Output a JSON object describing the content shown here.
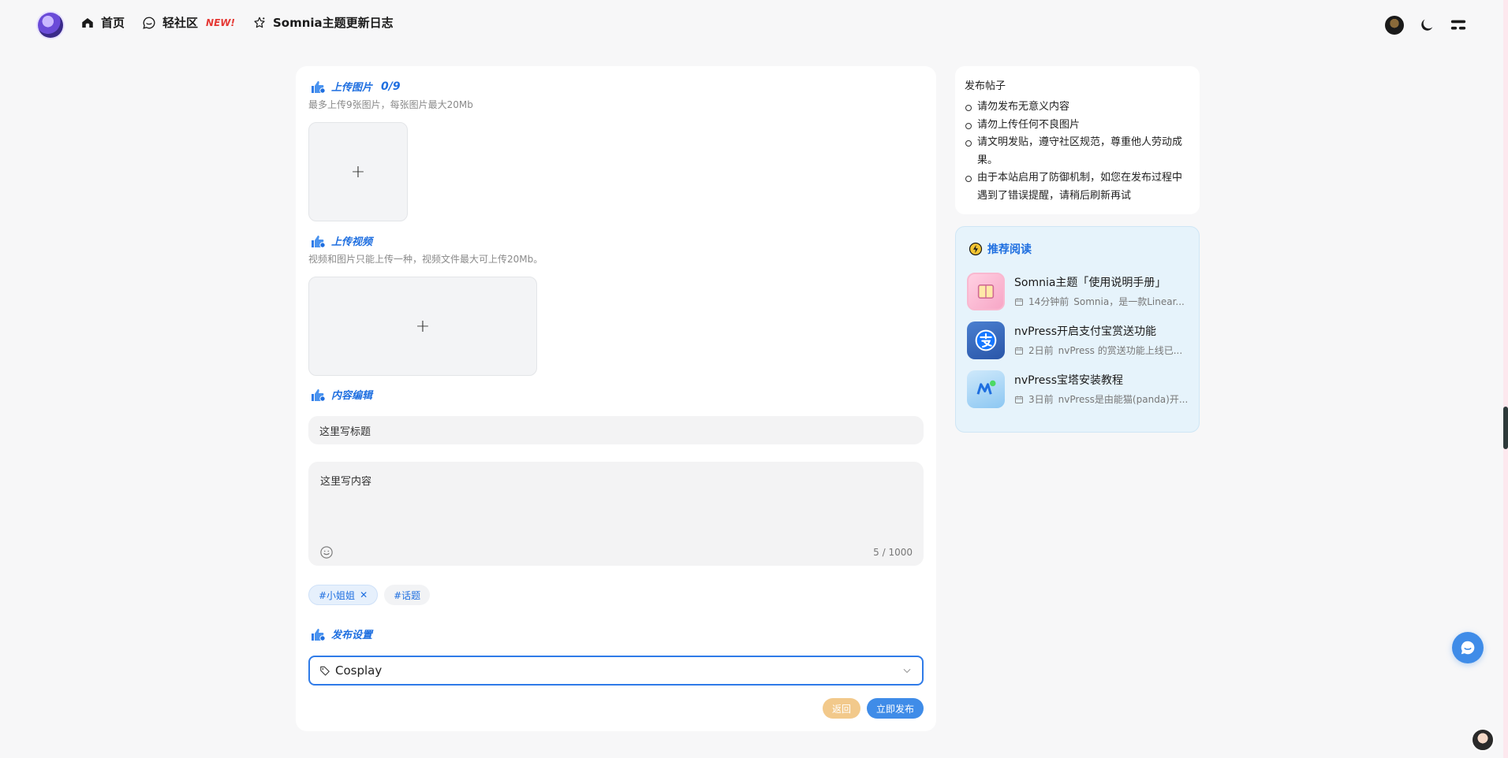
{
  "nav": {
    "home_label": "首页",
    "community_label": "轻社区",
    "community_badge": "NEW!",
    "changelog_label": "Somnia主题更新日志"
  },
  "upload_images": {
    "title": "上传图片",
    "count": "0/9",
    "hint": "最多上传9张图片，每张图片最大20Mb",
    "plus": "+"
  },
  "upload_video": {
    "title": "上传视频",
    "hint": "视频和图片只能上传一种，视频文件最大可上传20Mb。",
    "plus": "+"
  },
  "content_edit": {
    "title": "内容编辑",
    "title_placeholder": "这里写标题",
    "content_placeholder": "这里写内容",
    "counter": "5 / 1000"
  },
  "tags": [
    {
      "label": "#小姐姐",
      "close": "✕"
    },
    {
      "label": "#话题"
    }
  ],
  "publish_settings": {
    "title": "发布设置",
    "category": "Cosplay"
  },
  "buttons": {
    "back": "返回",
    "publish": "立即发布"
  },
  "rules": {
    "title": "发布帖子",
    "items": [
      "请勿发布无意义内容",
      "请勿上传任何不良图片",
      "请文明发贴，遵守社区规范，尊重他人劳动成果。",
      "由于本站启用了防御机制，如您在发布过程中遇到了错误提醒，请稍后刷新再试"
    ]
  },
  "recommend": {
    "title": "推荐阅读",
    "items": [
      {
        "title": "Somnia主题「使用说明手册」",
        "time": "14分钟前",
        "excerpt": "Somnia，是一款Linear..."
      },
      {
        "title": "nvPress开启支付宝赏送功能",
        "time": "2日前",
        "excerpt": "nvPress 的赏送功能上线已..."
      },
      {
        "title": "nvPress宝塔安装教程",
        "time": "3日前",
        "excerpt": "nvPress是由能猫(panda)开..."
      }
    ]
  },
  "colors": {
    "accent": "#1f6fe0",
    "publish_button": "#3f8ce8",
    "back_button": "#f2c98b"
  }
}
